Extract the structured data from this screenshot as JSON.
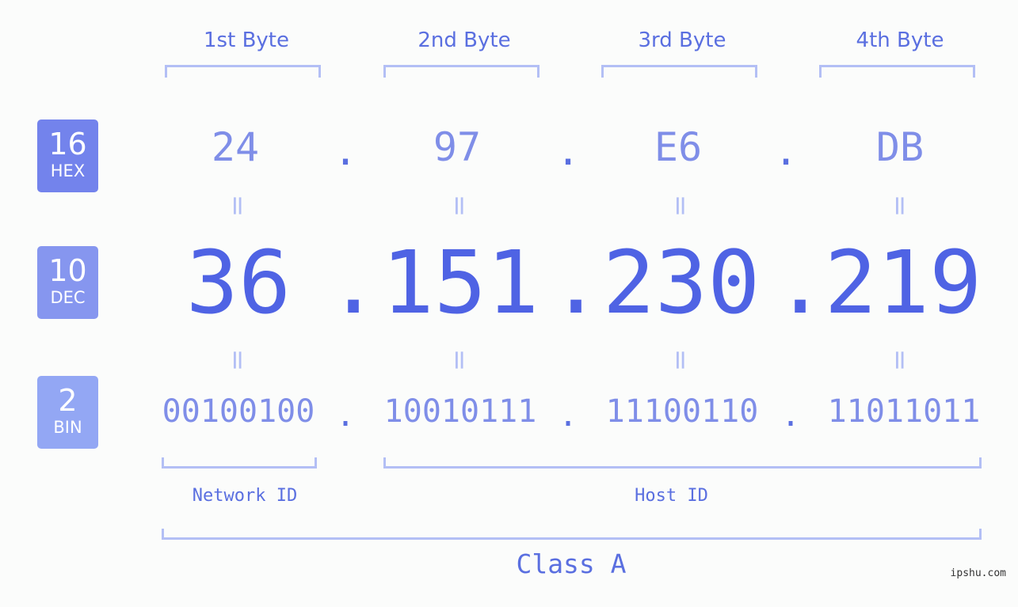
{
  "badges": [
    {
      "number": "16",
      "label": "HEX",
      "color": "#7383ec"
    },
    {
      "number": "10",
      "label": "DEC",
      "color": "#8696ef"
    },
    {
      "number": "2",
      "label": "BIN",
      "color": "#93a7f4"
    }
  ],
  "bytes": [
    {
      "header": "1st Byte",
      "hex": "24",
      "dec": "36",
      "bin": "00100100"
    },
    {
      "header": "2nd Byte",
      "hex": "97",
      "dec": "151",
      "bin": "10010111"
    },
    {
      "header": "3rd Byte",
      "hex": "E6",
      "dec": "230",
      "bin": "11100110"
    },
    {
      "header": "4th Byte",
      "hex": "DB",
      "dec": "219",
      "bin": "11011011"
    }
  ],
  "separator": ".",
  "equals_symbol": "=",
  "network_id_label": "Network ID",
  "host_id_label": "Host ID",
  "class_label": "Class A",
  "watermark": "ipshu.com"
}
